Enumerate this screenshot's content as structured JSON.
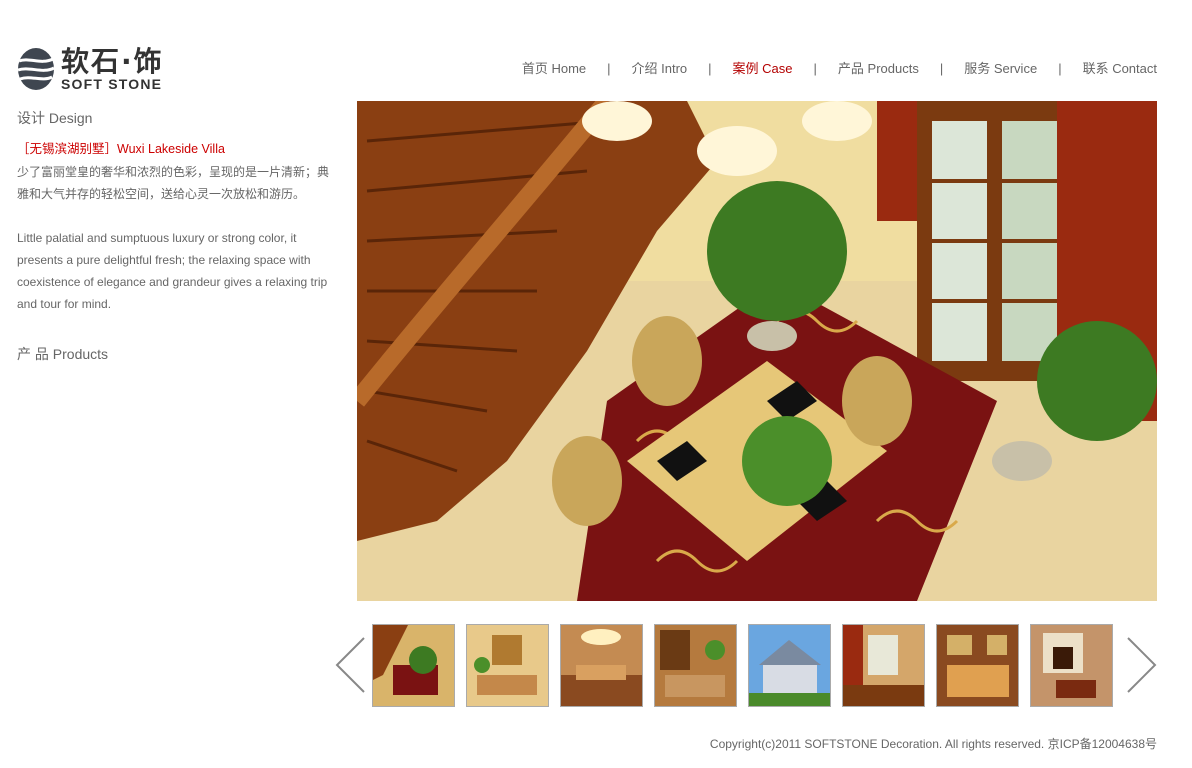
{
  "logo": {
    "cn": "软石·饰",
    "en": "SOFT STONE"
  },
  "nav": [
    {
      "label": "首页 Home",
      "active": false
    },
    {
      "label": "介绍 Intro",
      "active": false
    },
    {
      "label": "案例 Case",
      "active": true
    },
    {
      "label": "产品 Products",
      "active": false
    },
    {
      "label": "服务 Service",
      "active": false
    },
    {
      "label": "联系 Contact",
      "active": false
    }
  ],
  "nav_separator": "|",
  "sidebar": {
    "design_title": "设计 Design",
    "project_title": "［无锡滨湖别墅］Wuxi Lakeside Villa",
    "desc_cn": "少了富丽堂皇的奢华和浓烈的色彩，呈现的是一片清新；典雅和大气并存的轻松空间，送给心灵一次放松和游历。",
    "desc_en": "Little palatial and sumptuous luxury or strong color, it presents a pure delightful fresh; the relaxing space with coexistence of elegance and grandeur gives a relaxing trip and tour for mind.",
    "products_title": "产 品 Products"
  },
  "footer": {
    "copyright": "Copyright(c)2011 SOFTSTONE Decoration. All rights reserved. 京ICP备12004638号"
  },
  "colors": {
    "accent": "#b30000",
    "text": "#666666"
  }
}
